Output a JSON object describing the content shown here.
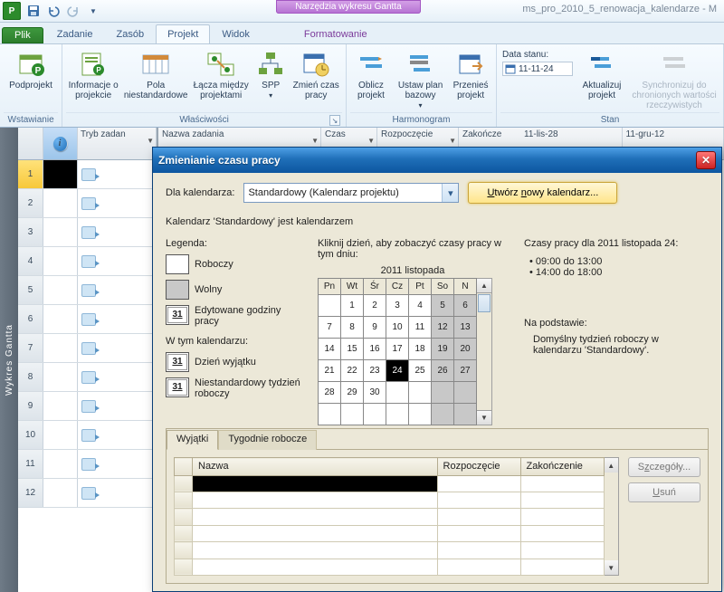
{
  "titlebar": {
    "doc_title": "ms_pro_2010_5_renowacja_kalendarze - M",
    "context_label": "Narzędzia wykresu Gantta",
    "app_letter": "P"
  },
  "tabs": {
    "file": "Plik",
    "t1": "Zadanie",
    "t2": "Zasób",
    "t3": "Projekt",
    "t4": "Widok",
    "ctx": "Formatowanie"
  },
  "ribbon": {
    "grp_insert": "Wstawianie",
    "btn_subproject": "Podprojekt",
    "grp_props": "Właściwości",
    "btn_info": "Informacje o projekcie",
    "btn_fields": "Pola niestandardowe",
    "btn_links": "Łącza między projektami",
    "btn_wbs": "SPP",
    "btn_worktime": "Zmień czas pracy",
    "grp_schedule": "Harmonogram",
    "btn_calc": "Oblicz projekt",
    "btn_baseline": "Ustaw plan bazowy",
    "btn_move": "Przenieś projekt",
    "grp_status": "Stan",
    "status_label": "Data stanu:",
    "status_value": "11-11-24",
    "btn_update": "Aktualizuj projekt",
    "btn_sync": "Synchronizuj do chronionych wartości rzeczywistych"
  },
  "grid": {
    "col_info": "i",
    "col_mode": "Tryb zadan",
    "col_name": "Nazwa zadania",
    "col_dur": "Czas",
    "col_start": "Rozpoczęcie",
    "col_end": "Zakończe",
    "rows": [
      "1",
      "2",
      "3",
      "4",
      "5",
      "6",
      "7",
      "8",
      "9",
      "10",
      "11",
      "12"
    ]
  },
  "gantt": {
    "label": "Wykres Gantta",
    "wk1": "11-lis-28",
    "wk2": "11-gru-12"
  },
  "dialog": {
    "title": "Zmienianie czasu pracy",
    "for_label": "Dla kalendarza:",
    "combo_value": "Standardowy (Kalendarz projektu)",
    "new_btn": "Utwórz nowy kalendarz...",
    "statement": "Kalendarz 'Standardowy' jest kalendarzem",
    "legend": {
      "title": "Legenda:",
      "working": "Roboczy",
      "nonworking": "Wolny",
      "edited": "Edytowane godziny pracy",
      "subtitle": "W tym kalendarzu:",
      "exception": "Dzień wyjątku",
      "nondefault": "Niestandardowy tydzień roboczy",
      "box": "31"
    },
    "calendar": {
      "hint": "Kliknij dzień, aby zobaczyć czasy pracy w tym dniu:",
      "month": "2011 listopada",
      "days": [
        "Pn",
        "Wt",
        "Śr",
        "Cz",
        "Pt",
        "So",
        "N"
      ],
      "weeks": [
        [
          null,
          1,
          2,
          3,
          4,
          5,
          6
        ],
        [
          7,
          8,
          9,
          10,
          11,
          12,
          13
        ],
        [
          14,
          15,
          16,
          17,
          18,
          19,
          20
        ],
        [
          21,
          22,
          23,
          24,
          25,
          26,
          27
        ],
        [
          28,
          29,
          30,
          null,
          null,
          null,
          null
        ],
        [
          null,
          null,
          null,
          null,
          null,
          null,
          null
        ]
      ],
      "selected": 24,
      "gray_cols": [
        5,
        6
      ]
    },
    "right": {
      "heading": "Czasy pracy dla 2011 listopada 24:",
      "t1": "09:00 do 13:00",
      "t2": "14:00 do 18:00",
      "basis_h": "Na podstawie:",
      "basis_t": "Domyślny tydzień roboczy w kalendarzu 'Standardowy'."
    },
    "exceptions": {
      "tab1": "Wyjątki",
      "tab2": "Tygodnie robocze",
      "col_name": "Nazwa",
      "col_start": "Rozpoczęcie",
      "col_end": "Zakończenie",
      "btn_details": "Szczegóły...",
      "btn_delete": "Usuń"
    }
  }
}
